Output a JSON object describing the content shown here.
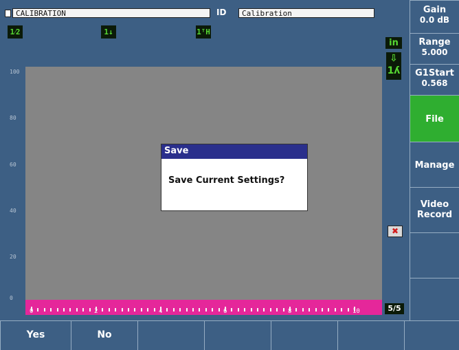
{
  "header": {
    "setup_name": "CALIBRATION",
    "id_label": "ID",
    "id_value": "Calibration"
  },
  "indicators": {
    "scale_indicator": "1⁄2",
    "gate_indicator_1": "1↓",
    "gate_indicator_2": "1ᵀH",
    "units": "in",
    "page": "5/5"
  },
  "y_axis": {
    "ticks": [
      "100",
      "80",
      "60",
      "40",
      "20",
      "0"
    ]
  },
  "x_ruler": {
    "labels": [
      "0",
      "2",
      "4",
      "6",
      "8",
      "10"
    ]
  },
  "dialog": {
    "title": "Save",
    "message": "Save Current Settings?"
  },
  "right_panel": {
    "gain": {
      "label": "Gain",
      "value": "0.0 dB"
    },
    "range": {
      "label": "Range",
      "value": "5.000"
    },
    "g1start": {
      "label": "G1Start",
      "value": "0.568"
    },
    "file": {
      "label": "File"
    },
    "manage": {
      "label": "Manage"
    },
    "video": {
      "label1": "Video",
      "label2": "Record"
    }
  },
  "bottom_buttons": {
    "yes": "Yes",
    "no": "No"
  },
  "colors": {
    "background": "#3d5f84",
    "plot": "#858585",
    "ruler": "#e5279a",
    "dialog_title": "#2a2f8c",
    "active_key": "#2fae30",
    "indicator_green": "#56d833"
  }
}
